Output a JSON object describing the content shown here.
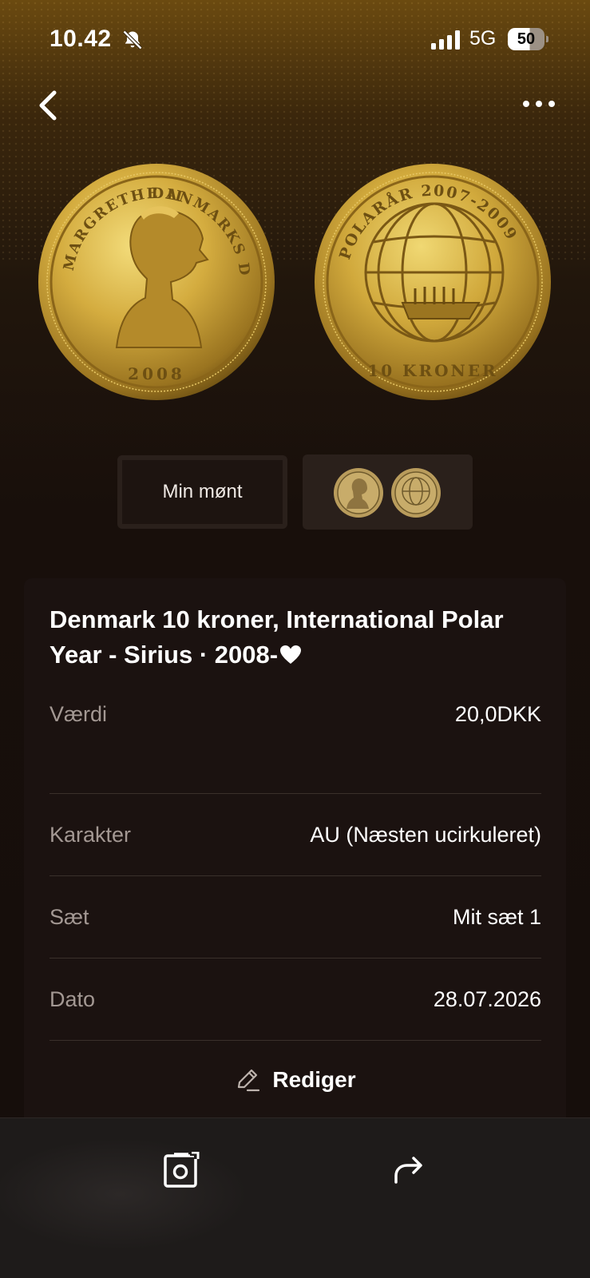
{
  "status_bar": {
    "time": "10.42",
    "network": "5G",
    "battery": "50"
  },
  "icons": {
    "back": "chevron-left-icon",
    "more": "ellipsis-icon",
    "bell_muted": "bell-slash-icon",
    "signal": "signal-bars-icon",
    "edit": "pencil-icon",
    "camera": "camera-frame-icon",
    "share": "share-arrow-icon",
    "favorite": "heart-icon"
  },
  "coin_images": {
    "obverse": {
      "inscription_top": "DANMARKS DRONNING",
      "inscription_left": "MARGRETHE II",
      "year": "2008"
    },
    "reverse": {
      "inscription_top": "POLARÅR 2007-2009",
      "denomination": "10 KRONER"
    }
  },
  "thumbnails": {
    "mine_label": "Min mønt"
  },
  "coin": {
    "title": "Denmark 10 kroner, International Polar Year - Sirius · 2008-"
  },
  "details": [
    {
      "label": "Værdi",
      "value": "20,0DKK"
    },
    {
      "label": "Karakter",
      "value": "AU (Næsten ucirkuleret)"
    },
    {
      "label": "Sæt",
      "value": "Mit sæt 1"
    },
    {
      "label": "Dato",
      "value": "28.07.2026"
    }
  ],
  "actions": {
    "edit_label": "Rediger"
  },
  "colors": {
    "gold": "#c9a23a",
    "card_bg": "#1b1210",
    "label_gray": "#a39893"
  }
}
